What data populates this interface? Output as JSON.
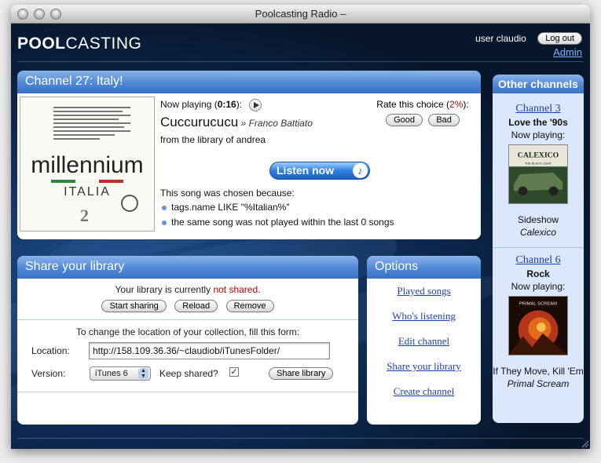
{
  "window": {
    "title": "Poolcasting Radio –"
  },
  "header": {
    "logo_bold": "POOL",
    "logo_rest": "CASTING",
    "user_text": "user claudio",
    "logout_label": "Log out",
    "admin_label": "Admin"
  },
  "now": {
    "title_prefix": "Channel 27: ",
    "title_name": "Italy!",
    "album": {
      "title": "millennium",
      "subtitle": "ITALIA",
      "number": "2"
    },
    "now_playing_label": "Now playing (",
    "elapsed": "0:16",
    "now_playing_suffix": "):",
    "song": "Cuccurucucu",
    "separator": " » ",
    "artist": "Franco Battiato",
    "from_prefix": "from the library of ",
    "from_user": "andrea",
    "rate_label_prefix": "Rate this choice (",
    "rate_pct": "2%",
    "rate_label_suffix": "):",
    "good_label": "Good",
    "bad_label": "Bad",
    "listen_label": "Listen now",
    "reason_intro": "This song was chosen because:",
    "reasons": [
      "tags.name LIKE \"%Italian%\"",
      "the same song was not played within the last 0 songs"
    ]
  },
  "share": {
    "title": "Share your library",
    "status_prefix": "Your library is currently ",
    "status_value": "not shared.",
    "buttons": [
      "Start sharing",
      "Reload",
      "Remove"
    ],
    "form_intro": "To change the location of your collection, fill this form:",
    "location_label": "Location:",
    "location_value": "http://158.109.36.36/~claudiob/iTunesFolder/",
    "version_label": "Version:",
    "version_value": "iTunes 6",
    "keep_label": "Keep shared?",
    "keep_checked": true,
    "share_button": "Share library"
  },
  "options": {
    "title": "Options",
    "links": [
      "Played songs",
      "Who's listening",
      "Edit channel",
      "Share your library",
      "Create channel"
    ]
  },
  "other": {
    "title": "Other channels",
    "now_playing_label": "Now playing:",
    "channels": [
      {
        "link": "Channel 3",
        "name": "Love the '90s",
        "song": "Sideshow",
        "artist": "Calexico",
        "art_text": "CALEXICO",
        "art_sub": "THE BLACK LIGHT"
      },
      {
        "link": "Channel 6",
        "name": "Rock",
        "song": "If They Move, Kill 'Em",
        "artist": "Primal Scream",
        "art_text": "PRIMAL SCREAM"
      }
    ]
  },
  "colors": {
    "accent": "#4f88d6",
    "background": "#0f2f5c",
    "link": "#1d3fb8",
    "warning": "#b00000"
  }
}
